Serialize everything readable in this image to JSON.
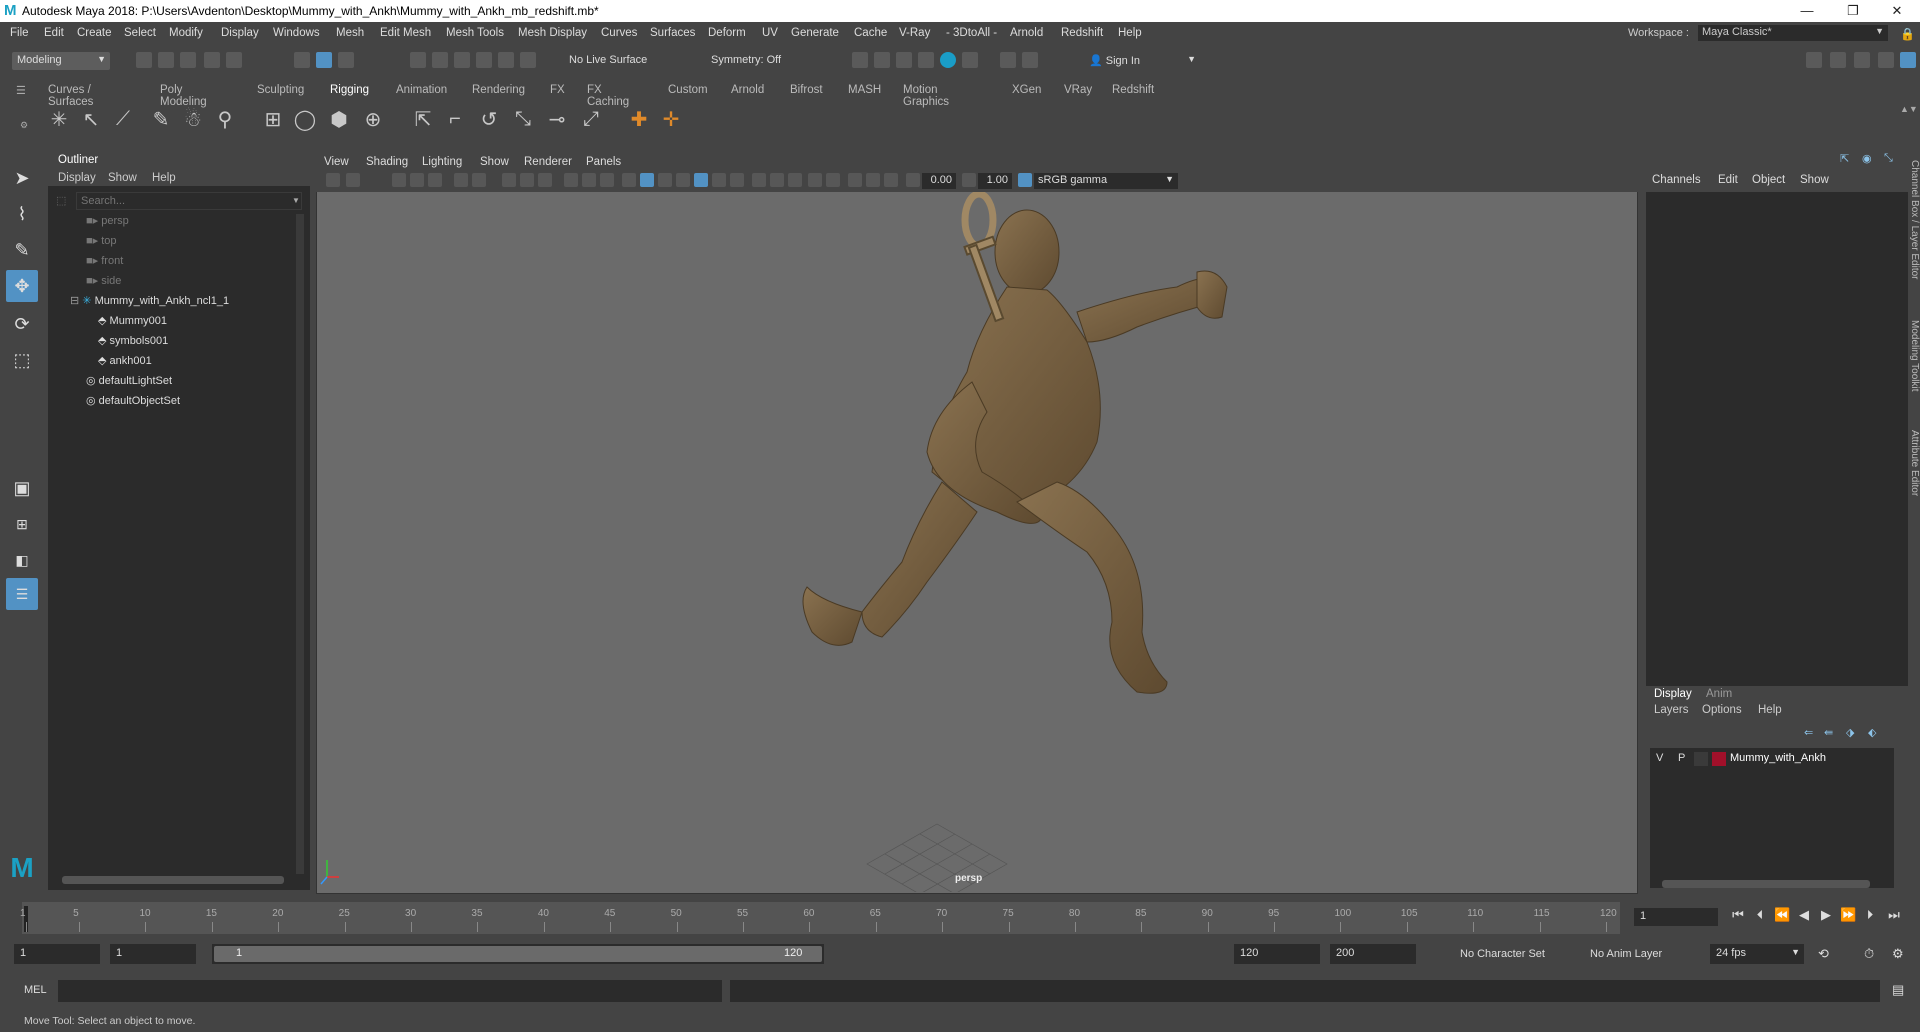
{
  "window": {
    "title": "Autodesk Maya 2018: P:\\Users\\Avdenton\\Desktop\\Mummy_with_Ankh\\Mummy_with_Ankh_mb_redshift.mb*",
    "minimize": "—",
    "maximize": "❐",
    "close": "✕"
  },
  "menus": [
    "File",
    "Edit",
    "Create",
    "Select",
    "Modify",
    "Display",
    "Windows",
    "Mesh",
    "Edit Mesh",
    "Mesh Tools",
    "Mesh Display",
    "Curves",
    "Surfaces",
    "Deform",
    "UV",
    "Generate",
    "Cache",
    "V-Ray",
    "- 3DtoAll -",
    "Arnold",
    "Redshift",
    "Help"
  ],
  "workspace": {
    "label": "Workspace :",
    "value": "Maya Classic*"
  },
  "status": {
    "menuset": "Modeling",
    "live_surface": "No Live Surface",
    "symmetry": "Symmetry: Off",
    "sign_in": "Sign In"
  },
  "shelf_tabs": [
    "Curves / Surfaces",
    "Poly Modeling",
    "Sculpting",
    "Rigging",
    "Animation",
    "Rendering",
    "FX",
    "FX Caching",
    "Custom",
    "Arnold",
    "Bifrost",
    "MASH",
    "Motion Graphics",
    "XGen",
    "VRay",
    "Redshift"
  ],
  "active_shelf": "Rigging",
  "outliner": {
    "title": "Outliner",
    "menus": [
      "Display",
      "Show",
      "Help"
    ],
    "search_placeholder": "Search...",
    "items": [
      {
        "label": "persp",
        "dim": true,
        "indent": 0
      },
      {
        "label": "top",
        "dim": true,
        "indent": 0
      },
      {
        "label": "front",
        "dim": true,
        "indent": 0
      },
      {
        "label": "side",
        "dim": true,
        "indent": 0
      },
      {
        "label": "Mummy_with_Ankh_ncl1_1",
        "dim": false,
        "indent": 0
      },
      {
        "label": "Mummy001",
        "dim": false,
        "indent": 1
      },
      {
        "label": "symbols001",
        "dim": false,
        "indent": 1
      },
      {
        "label": "ankh001",
        "dim": false,
        "indent": 1
      },
      {
        "label": "defaultLightSet",
        "dim": false,
        "indent": 0
      },
      {
        "label": "defaultObjectSet",
        "dim": false,
        "indent": 0
      }
    ]
  },
  "viewport": {
    "menus": [
      "View",
      "Shading",
      "Lighting",
      "Show",
      "Renderer",
      "Panels"
    ],
    "near": "0.00",
    "gamma_val": "1.00",
    "colorspace": "sRGB gamma",
    "camera_label": "persp"
  },
  "channel_box": {
    "menus": [
      "Channels",
      "Edit",
      "Object",
      "Show"
    ]
  },
  "layer_editor": {
    "tabs": [
      "Display",
      "Anim"
    ],
    "menus": [
      "Layers",
      "Options",
      "Help"
    ],
    "layer": {
      "v": "V",
      "p": "P",
      "name": "Mummy_with_Ankh",
      "color": "#a1102a"
    }
  },
  "side_tabs": [
    "Channel Box / Layer Editor",
    "Modeling Toolkit",
    "Attribute Editor"
  ],
  "timeline": {
    "ticks": [
      "1",
      "5",
      "10",
      "15",
      "20",
      "25",
      "30",
      "35",
      "40",
      "45",
      "50",
      "55",
      "60",
      "65",
      "70",
      "75",
      "80",
      "85",
      "90",
      "95",
      "100",
      "105",
      "110",
      "115",
      "120"
    ],
    "current_frame": "1"
  },
  "range": {
    "start": "1",
    "inner_start": "1",
    "slider_start": "1",
    "slider_end": "120",
    "end": "120",
    "outer_end": "200",
    "char_set": "No Character Set",
    "anim_layer": "No Anim Layer",
    "fps": "24 fps"
  },
  "mel": {
    "label": "MEL"
  },
  "helpline": "Move Tool: Select an object to move."
}
